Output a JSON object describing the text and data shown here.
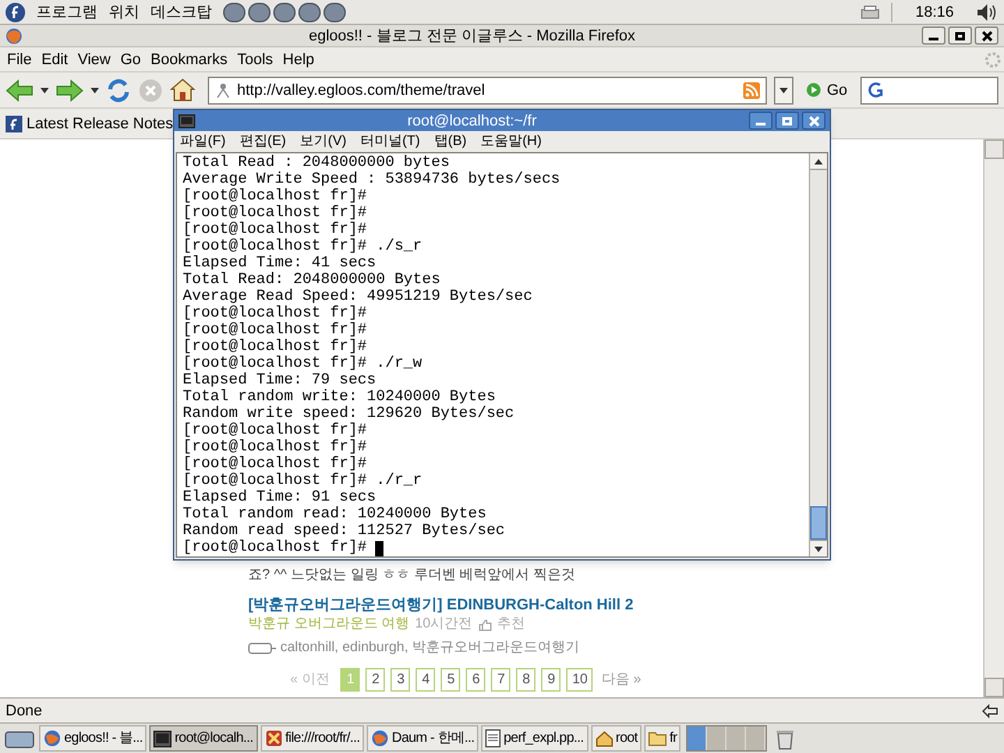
{
  "top_panel": {
    "menus": [
      "프로그램",
      "위치",
      "데스크탑"
    ],
    "clock": "18:16"
  },
  "browser": {
    "title": "egloos!! - 블로그 전문 이글루스 - Mozilla Firefox",
    "menu": [
      "File",
      "Edit",
      "View",
      "Go",
      "Bookmarks",
      "Tools",
      "Help"
    ],
    "url": "http://valley.egloos.com/theme/travel",
    "go": "Go",
    "bookmarks": [
      "Latest Release Notes"
    ],
    "post": {
      "snippet": "죠? ^^ 느닷없는 일링 ㅎㅎ 루더벤 베럭앞에서 찍은것",
      "title": "[박훈규오버그라운드여행기] EDINBURGH-Calton Hill 2",
      "blog": "박훈규 오버그라운드 여행",
      "time": "10시간전",
      "recommend": "추천",
      "tags": "caltonhill, edinburgh, 박훈규오버그라운드여행기"
    },
    "pagination": {
      "prev": "« 이전",
      "next": "다음 »",
      "pages": [
        {
          "label": "1",
          "selected": true
        },
        {
          "label": "2",
          "selected": false
        },
        {
          "label": "3",
          "selected": false
        },
        {
          "label": "4",
          "selected": false
        },
        {
          "label": "5",
          "selected": false
        },
        {
          "label": "6",
          "selected": false
        },
        {
          "label": "7",
          "selected": false
        },
        {
          "label": "8",
          "selected": false
        },
        {
          "label": "9",
          "selected": false
        },
        {
          "label": "10",
          "selected": false
        }
      ]
    },
    "status": "Done"
  },
  "terminal": {
    "title": "root@localhost:~/fr",
    "menu": [
      "파일(F)",
      "편집(E)",
      "보기(V)",
      "터미널(T)",
      "탭(B)",
      "도움말(H)"
    ],
    "lines": [
      "Total Read : 2048000000 bytes",
      "Average Write Speed : 53894736 bytes/secs",
      "[root@localhost fr]#",
      "[root@localhost fr]#",
      "[root@localhost fr]#",
      "[root@localhost fr]# ./s_r",
      "Elapsed Time: 41 secs",
      "Total Read: 2048000000 Bytes",
      "Average Read Speed: 49951219 Bytes/sec",
      "[root@localhost fr]#",
      "[root@localhost fr]#",
      "[root@localhost fr]#",
      "[root@localhost fr]# ./r_w",
      "Elapsed Time: 79 secs",
      "Total random write: 10240000 Bytes",
      "Random write speed: 129620 Bytes/sec",
      "[root@localhost fr]#",
      "[root@localhost fr]#",
      "[root@localhost fr]#",
      "[root@localhost fr]# ./r_r",
      "Elapsed Time: 91 secs",
      "Total random read: 10240000 Bytes",
      "Random read speed: 112527 Bytes/sec",
      "[root@localhost fr]#"
    ]
  },
  "taskbar": [
    {
      "label": "egloos!! - 블...",
      "kind": "browser",
      "selected": false
    },
    {
      "label": "root@localh...",
      "kind": "terminal",
      "selected": true
    },
    {
      "label": "file:///root/fr/...",
      "kind": "files",
      "selected": false
    },
    {
      "label": "Daum - 한메...",
      "kind": "browser",
      "selected": false
    },
    {
      "label": "perf_expl.pp...",
      "kind": "document",
      "selected": false
    },
    {
      "label": "root",
      "kind": "home",
      "selected": false
    },
    {
      "label": "fr",
      "kind": "folder",
      "selected": false
    }
  ],
  "workspaces": [
    {
      "selected": true
    },
    {
      "selected": false
    },
    {
      "selected": false
    },
    {
      "selected": false
    }
  ]
}
